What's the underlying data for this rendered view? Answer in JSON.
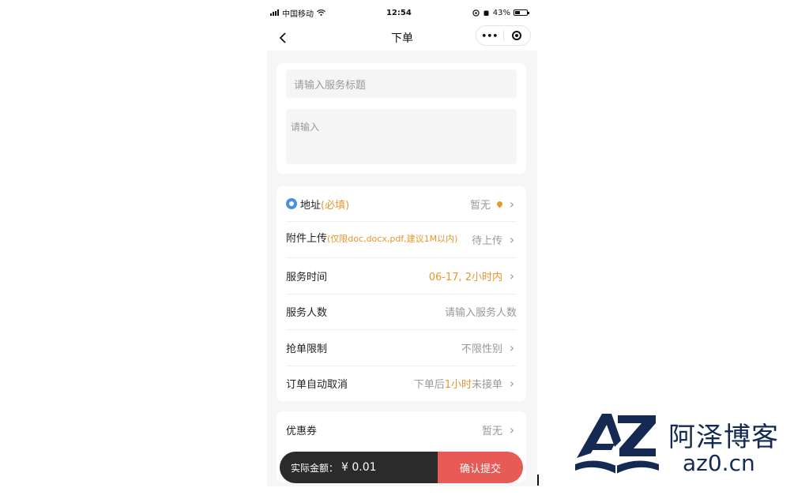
{
  "status_bar": {
    "carrier": "中国移动",
    "time": "12:54",
    "battery": "43%",
    "battery_level": 0.43
  },
  "nav": {
    "back_icon": "chevron-left-icon",
    "title": "下单",
    "more_icon": "•••"
  },
  "form": {
    "title_placeholder": "请输入服务标题",
    "body_placeholder": "请输入"
  },
  "rows": {
    "address": {
      "label": "地址",
      "required": "(必填)",
      "value": "暂无"
    },
    "attachment": {
      "label": "附件上传",
      "hint": "(仅限doc,docx,pdf,建议1M以内)",
      "value": "待上传"
    },
    "service_time": {
      "label": "服务时间",
      "value": "06-17, 2小时内"
    },
    "people": {
      "label": "服务人数",
      "placeholder": "请输入服务人数"
    },
    "grab_limit": {
      "label": "抢单限制",
      "value": "不限性别"
    },
    "auto_cancel": {
      "label": "订单自动取消",
      "value_prefix": "下单后",
      "value_highlight": "1小时",
      "value_suffix": "未接单"
    }
  },
  "coupon": {
    "label": "优惠券",
    "value": "暂无"
  },
  "bottom": {
    "amount_label": "实际金额：",
    "amount": "¥ 0.01",
    "submit": "确认提交"
  },
  "watermark": {
    "logo_text": "AZ",
    "name": "阿泽博客",
    "url": "az0.cn"
  },
  "colors": {
    "accent_orange": "#e8962e",
    "submit_red": "#e85a55",
    "logo_navy": "#142a52"
  }
}
